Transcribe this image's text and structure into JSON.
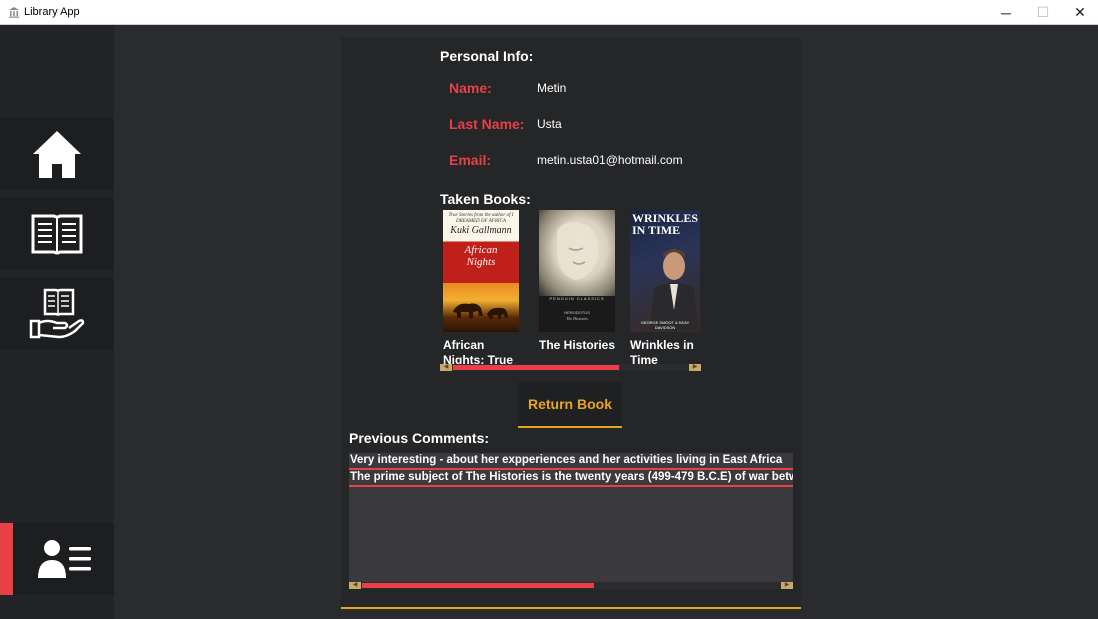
{
  "window": {
    "title": "Library App",
    "controls": {
      "minimize": "─",
      "maximize": "☐",
      "close": "✕"
    }
  },
  "sidebar": {
    "items": [
      {
        "name": "home",
        "icon": "home-icon",
        "active": false
      },
      {
        "name": "books",
        "icon": "open-book-icon",
        "active": false
      },
      {
        "name": "borrow",
        "icon": "book-hand-icon",
        "active": false
      },
      {
        "name": "profile",
        "icon": "user-list-icon",
        "active": true
      }
    ],
    "accent": "#e84046"
  },
  "profile": {
    "section_title": "Personal Info:",
    "name_label": "Name:",
    "name_value": "Metin",
    "lastname_label": "Last Name:",
    "lastname_value": "Usta",
    "email_label": "Email:",
    "email_value": "metin.usta01@hotmail.com"
  },
  "taken_books": {
    "title": "Taken Books:",
    "books": [
      {
        "title": "African Nights: True Stories",
        "cover_text_top": "True Stories from the author of I DREAMED OF AFRICA",
        "cover_author": "Kuki Gallmann",
        "cover_title": "African Nights"
      },
      {
        "title": "The Histories",
        "cover_text_top": "PENGUIN CLASSICS",
        "cover_author": "HERODOTUS",
        "cover_title": "The Histories"
      },
      {
        "title": "Wrinkles in Time",
        "cover_text_top": "WRINKLES IN TIME",
        "cover_author": "GEORGE SMOOT & KEAY DAVIDSON",
        "cover_title": ""
      }
    ]
  },
  "actions": {
    "return_label": "Return Book"
  },
  "comments": {
    "title": "Previous Comments:",
    "items": [
      "Very interesting - about her expperiences and her activities living in East Africa",
      "The prime subject of The Histories is the twenty years (499-479 B.C.E) of war between Greece and Persia"
    ]
  },
  "colors": {
    "background": "#2a2b2e",
    "accent_red": "#e84046",
    "accent_gold": "#e8a520"
  }
}
